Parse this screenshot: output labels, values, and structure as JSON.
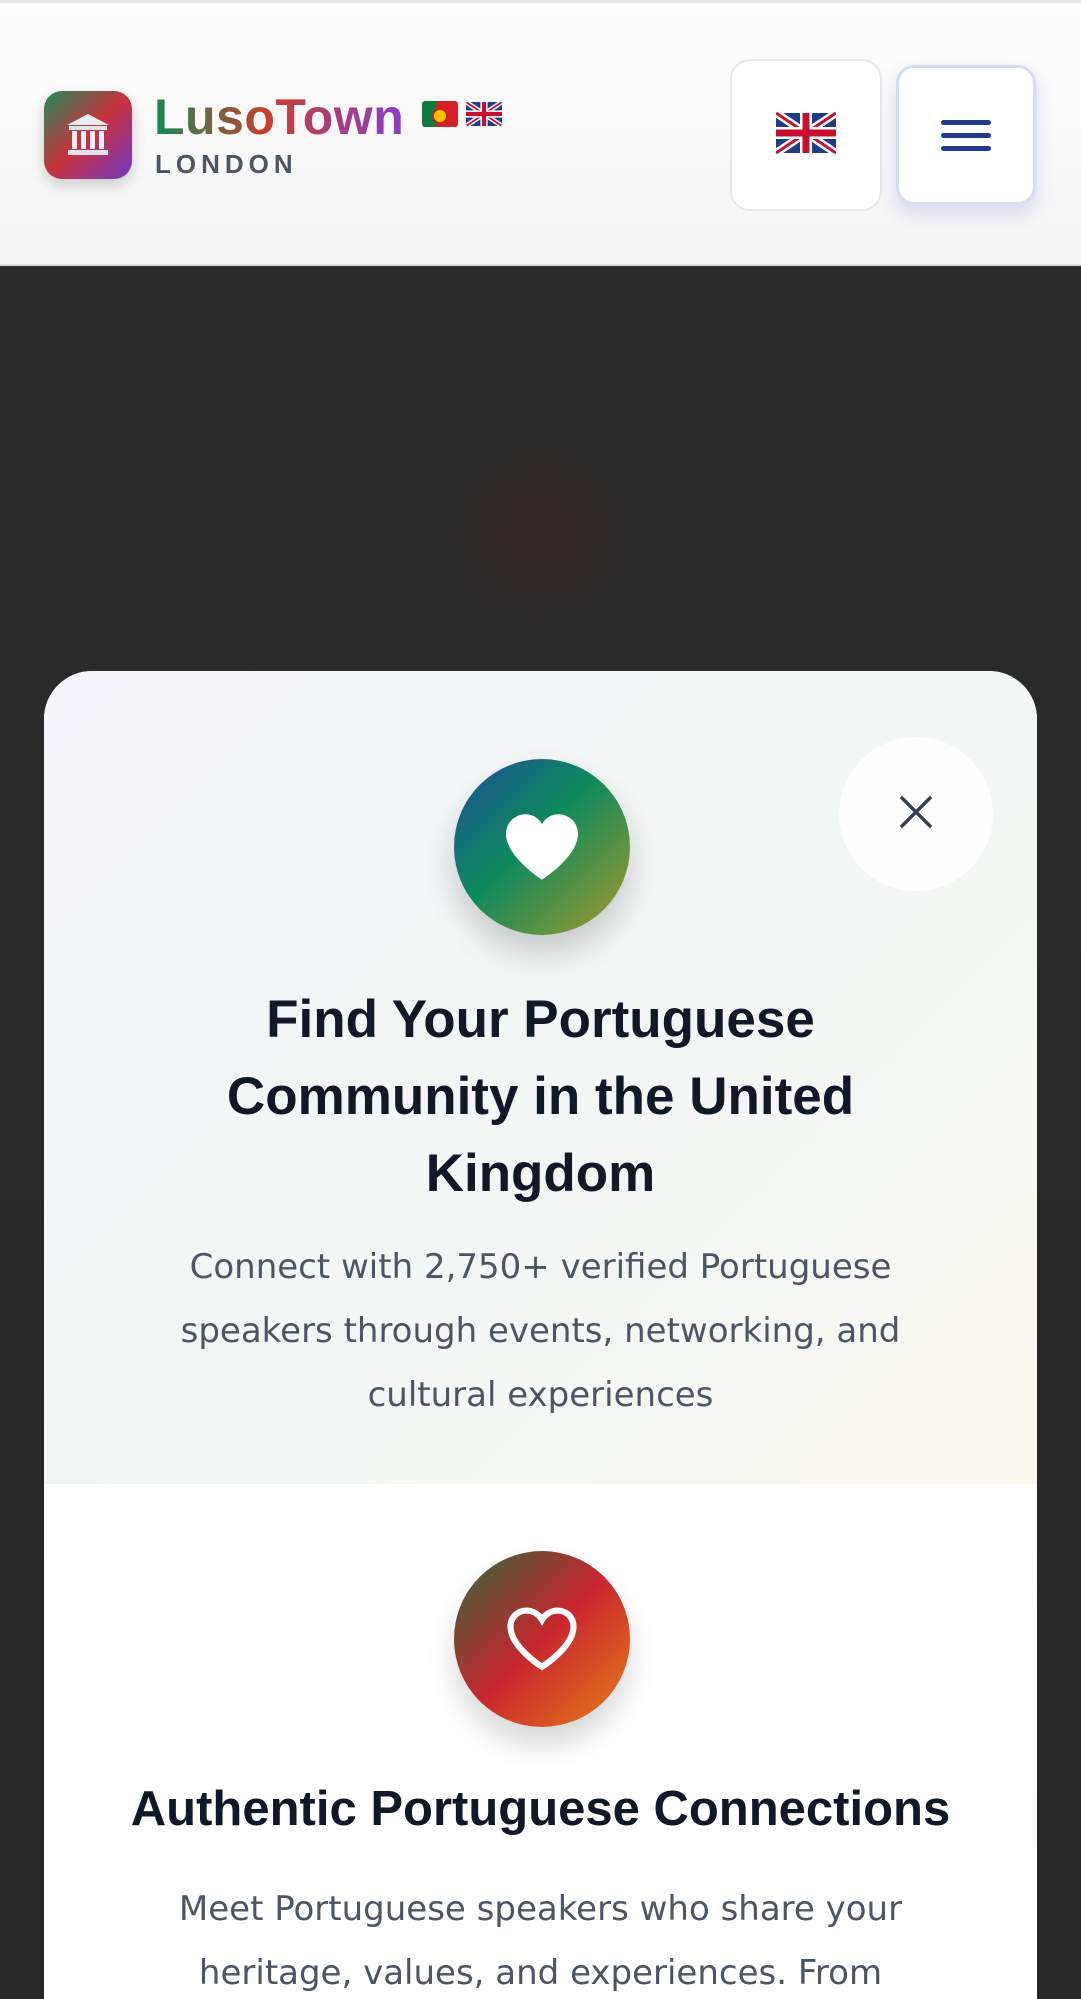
{
  "header": {
    "brand_name": "LusoTown",
    "brand_sub": "LONDON",
    "logo_icon": "classical-building-icon",
    "brand_flags": [
      "portugal-flag-icon",
      "uk-flag-icon"
    ],
    "language_button_icon": "uk-flag-icon",
    "menu_button_icon": "hamburger-menu-icon"
  },
  "modal": {
    "badge_icon": "heart-icon",
    "title": "Find Your Portuguese Community in the United Kingdom",
    "subtitle": "Connect with 2,750+ verified Portuguese speakers through events, networking, and cultural experiences",
    "close_icon": "close-icon",
    "feature": {
      "icon": "heart-outline-icon",
      "title": "Authentic Portuguese Connections",
      "text": "Meet Portuguese speakers who share your heritage, values, and experiences. From"
    }
  },
  "colors": {
    "menu_bars": "#1e3a8a",
    "title_text": "#111827",
    "body_text": "#4b5563",
    "badge_gradient": [
      "#1d4f99",
      "#0e8a5c",
      "#a89a2c"
    ],
    "feature_gradient": [
      "#2f6a3c",
      "#c8262e",
      "#e8801a"
    ]
  }
}
